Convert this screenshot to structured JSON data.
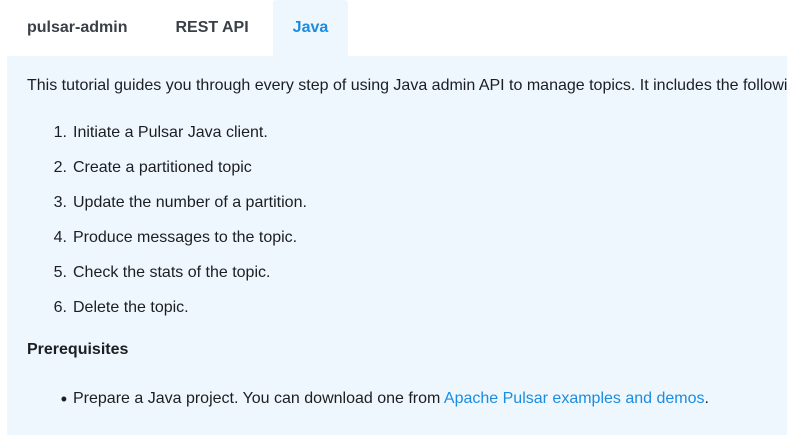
{
  "tabs": [
    {
      "label": "pulsar-admin",
      "active": false
    },
    {
      "label": "REST API",
      "active": false
    },
    {
      "label": "Java",
      "active": true
    }
  ],
  "intro": "This tutorial guides you through every step of using Java admin API to manage topics. It includes the followi",
  "steps": [
    {
      "num": "1.",
      "text": "Initiate a Pulsar Java client."
    },
    {
      "num": "2.",
      "text": "Create a partitioned topic"
    },
    {
      "num": "3.",
      "text": "Update the number of a partition."
    },
    {
      "num": "4.",
      "text": "Produce messages to the topic."
    },
    {
      "num": "5.",
      "text": "Check the stats of the topic."
    },
    {
      "num": "6.",
      "text": "Delete the topic."
    }
  ],
  "prerequisites": {
    "heading": "Prerequisites",
    "item_prefix": "Prepare a Java project. You can download one from ",
    "item_link": "Apache Pulsar examples and demos",
    "item_suffix": "."
  },
  "colors": {
    "accent": "#1b8ce0",
    "panel_bg": "#eef7fd",
    "text": "#1c1e21"
  }
}
